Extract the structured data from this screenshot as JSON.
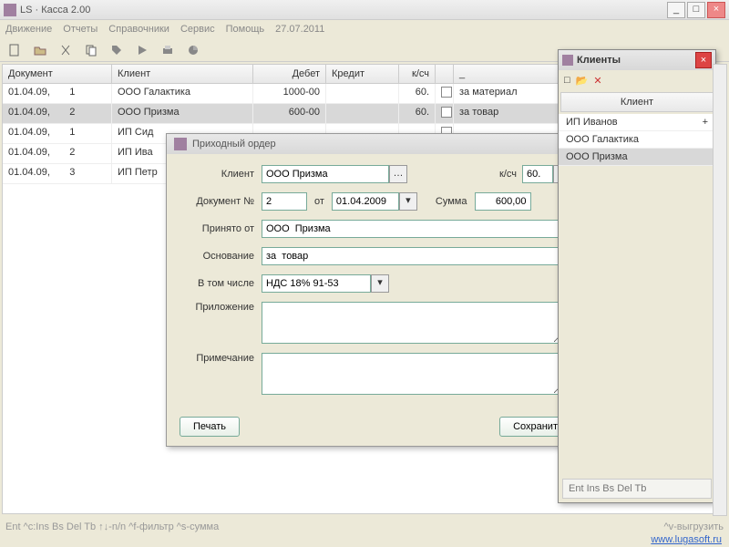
{
  "window": {
    "title": "LS · Касса 2.00"
  },
  "menu": {
    "items": [
      "Движение",
      "Отчеты",
      "Справочники",
      "Сервис",
      "Помощь"
    ],
    "date": "27.07.2011"
  },
  "grid": {
    "headers": {
      "doc": "Документ",
      "client": "Клиент",
      "debit": "Дебет",
      "credit": "Кредит",
      "ks": "к/сч",
      "note": "_"
    },
    "rows": [
      {
        "date": "01.04.09,",
        "num": "1",
        "client": "ООО Галактика",
        "debit": "1000-00",
        "credit": "",
        "ks": "60.",
        "note": "за материал"
      },
      {
        "date": "01.04.09,",
        "num": "2",
        "client": "ООО Призма",
        "debit": "600-00",
        "credit": "",
        "ks": "60.",
        "note": "за товар",
        "sel": true
      },
      {
        "date": "01.04.09,",
        "num": "1",
        "client": "ИП Сид",
        "debit": "",
        "credit": "",
        "ks": "",
        "note": ""
      },
      {
        "date": "01.04.09,",
        "num": "2",
        "client": "ИП Ива",
        "debit": "",
        "credit": "",
        "ks": "",
        "note": ""
      },
      {
        "date": "01.04.09,",
        "num": "3",
        "client": "ИП Петр",
        "debit": "",
        "credit": "",
        "ks": "",
        "note": ""
      }
    ]
  },
  "dialog": {
    "title": "Приходный ордер",
    "labels": {
      "client": "Клиент",
      "doc": "Документ №",
      "from": "от",
      "sum": "Сумма",
      "received": "Принято от",
      "basis": "Основание",
      "including": "В том числе",
      "attachment": "Приложение",
      "note": "Примечание"
    },
    "values": {
      "client": "ООО Призма",
      "ks_label": "к/сч",
      "ks": "60.",
      "docnum": "2",
      "date": "01.04.2009",
      "sum": "600,00",
      "received": "ООО  Призма",
      "basis": "за  товар",
      "including": "НДС 18% 91-53",
      "attachment": "",
      "note": ""
    },
    "buttons": {
      "print": "Печать",
      "save": "Сохранит"
    }
  },
  "panel": {
    "title": "Клиенты",
    "header": "Клиент",
    "items": [
      {
        "name": "ИП Иванов",
        "mark": "+"
      },
      {
        "name": "ООО Галактика",
        "mark": ""
      },
      {
        "name": "ООО Призма",
        "mark": "",
        "sel": true
      }
    ],
    "footer": "Ent Ins Bs Del Tb"
  },
  "status": {
    "hints": "Ent ^c:Ins Bs Del Tb  ↑↓-n/n  ^f-фильтр ^s-сумма",
    "right": "^v-выгрузить"
  },
  "link": "www.lugasoft.ru"
}
